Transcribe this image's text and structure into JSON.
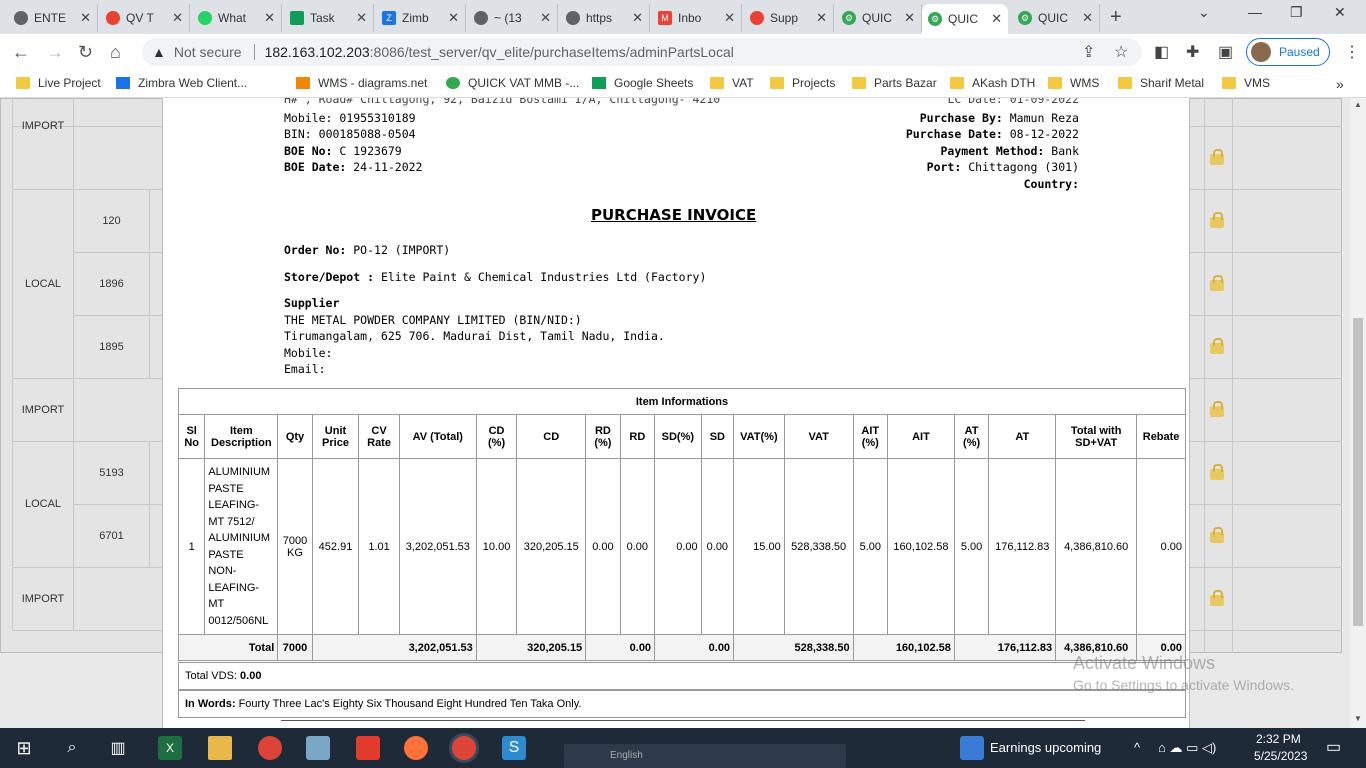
{
  "browser": {
    "tabs": [
      {
        "label": "ENTE",
        "color": "#5f6368"
      },
      {
        "label": "QV T",
        "color": "#e94235"
      },
      {
        "label": "What",
        "color": "#25d366"
      },
      {
        "label": "Task",
        "color": "#0f9d58"
      },
      {
        "label": "Zimb",
        "color": "#1a73e8"
      },
      {
        "label": "~ (13",
        "color": "#5f6368"
      },
      {
        "label": "https",
        "color": "#5f6368"
      },
      {
        "label": "Inbo",
        "color": "#ea4335"
      },
      {
        "label": "Supp",
        "color": "#e94235"
      },
      {
        "label": "QUIC",
        "color": "#34a853"
      },
      {
        "label": "QUIC",
        "color": "#34a853"
      },
      {
        "label": "QUIC",
        "color": "#34a853"
      }
    ],
    "active_tab": 10,
    "address": {
      "security": "Not secure",
      "host": "182.163.102.203",
      "path": ":8086/test_server/qv_elite/purchaseItems/adminPartsLocal"
    },
    "profile_status": "Paused",
    "bookmarks": [
      {
        "label": "Live Project",
        "type": "folder"
      },
      {
        "label": "Zimbra Web Client...",
        "type": "zimbra"
      },
      {
        "label": "WMS - diagrams.net",
        "type": "drawio"
      },
      {
        "label": "QUICK VAT MMB -...",
        "type": "gear"
      },
      {
        "label": "Google Sheets",
        "type": "sheets"
      },
      {
        "label": "VAT",
        "type": "folder"
      },
      {
        "label": "Projects",
        "type": "folder"
      },
      {
        "label": "Parts Bazar",
        "type": "folder"
      },
      {
        "label": "AKash DTH",
        "type": "folder"
      },
      {
        "label": "WMS",
        "type": "folder"
      },
      {
        "label": "Sharif Metal",
        "type": "folder"
      },
      {
        "label": "VMS",
        "type": "folder"
      }
    ]
  },
  "background_rows": [
    {
      "type": "IMPORT",
      "num": ""
    },
    {
      "type": "LOCAL",
      "nums": [
        "120",
        "1896",
        "1895"
      ]
    },
    {
      "type": "IMPORT",
      "num": ""
    },
    {
      "type": "LOCAL",
      "nums": [
        "5193",
        "6701"
      ]
    },
    {
      "type": "IMPORT",
      "num": ""
    }
  ],
  "invoice": {
    "left_header": {
      "address_partial": "H# , Road# Chittagong, 92, Baizid Bostami I/A, Chittagong- 4210",
      "mobile_label": "Mobile:",
      "mobile": "01955310189",
      "bin_label": "BIN:",
      "bin": "000185088-0504",
      "boe_no_label": "BOE No:",
      "boe_no": "C 1923679",
      "boe_date_label": "BOE Date:",
      "boe_date": "24-11-2022"
    },
    "right_header": {
      "lc_partial": "LC Date: 01-09-2022",
      "purchase_by_label": "Purchase By:",
      "purchase_by": "Mamun Reza",
      "purchase_date_label": "Purchase Date:",
      "purchase_date": "08-12-2022",
      "payment_method_label": "Payment Method:",
      "payment_method": "Bank",
      "port_label": "Port:",
      "port": "Chittagong (301)",
      "country_label": "Country:",
      "country": ""
    },
    "title": "PURCHASE INVOICE",
    "order_no_label": "Order No:",
    "order_no": "PO-12 (IMPORT)",
    "store_label": "Store/Depot :",
    "store": "Elite Paint & Chemical Industries Ltd (Factory)",
    "supplier_label": "Supplier",
    "supplier_name": "THE METAL POWDER COMPANY LIMITED (BIN/NID:)",
    "supplier_address": "Tirumangalam, 625 706. Madurai Dist, Tamil Nadu, India.",
    "supplier_mobile_label": "Mobile:",
    "supplier_email_label": "Email:",
    "table": {
      "caption": "Item Informations",
      "headers": [
        "Sl No",
        "Item Description",
        "Qty",
        "Unit Price",
        "CV Rate",
        "AV (Total)",
        "CD (%)",
        "CD",
        "RD (%)",
        "RD",
        "SD(%)",
        "SD",
        "VAT(%)",
        "VAT",
        "AIT (%)",
        "AIT",
        "AT (%)",
        "AT",
        "Total with SD+VAT",
        "Rebate"
      ],
      "row": {
        "sl": "1",
        "desc": "ALUMINIUM PASTE LEAFING-MT 7512/ ALUMINIUM PASTE NON-LEAFING-MT 0012/506NL",
        "qty": "7000 KG",
        "unit_price": "452.91",
        "cv_rate": "1.01",
        "av_total": "3,202,051.53",
        "cd_pct": "10.00",
        "cd": "320,205.15",
        "rd_pct": "0.00",
        "rd": "0.00",
        "sd_pct": "0.00",
        "sd": "0.00",
        "vat_pct": "15.00",
        "vat": "528,338.50",
        "ait_pct": "5.00",
        "ait": "160,102.58",
        "at_pct": "5.00",
        "at": "176,112.83",
        "total": "4,386,810.60",
        "rebate": "0.00"
      },
      "totals": {
        "label": "Total",
        "qty": "7000",
        "av_total": "3,202,051.53",
        "cd": "320,205.15",
        "rd": "0.00",
        "sd": "0.00",
        "vat": "528,338.50",
        "ait": "160,102.58",
        "at": "176,112.83",
        "total": "4,386,810.60",
        "rebate": "0.00"
      }
    },
    "total_vds_label": "Total VDS:",
    "total_vds": "0.00",
    "in_words_label": "In Words:",
    "in_words": "Fourty Three Lac's Eighty Six Thousand Eight Hundred Ten Taka Only."
  },
  "watermark": {
    "line1": "Activate Windows",
    "line2": "Go to Settings to activate Windows."
  },
  "taskbar": {
    "search_hint": "English",
    "weather": "Earnings upcoming",
    "time": "2:32 PM",
    "date": "5/25/2023"
  }
}
